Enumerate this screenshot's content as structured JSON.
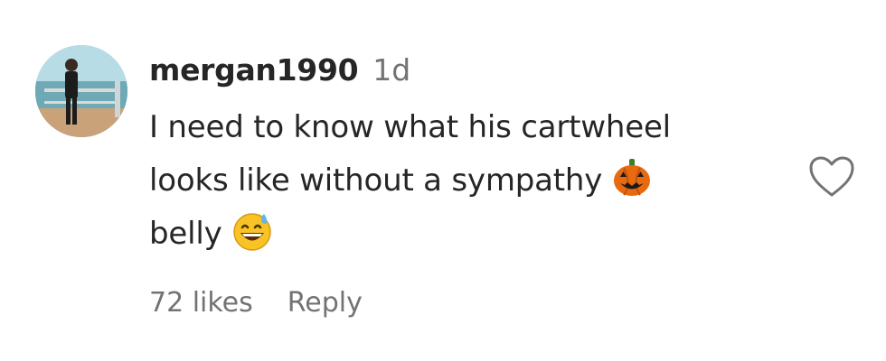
{
  "comment": {
    "username": "mergan1990",
    "time_ago": "1d",
    "text_line1": "I need to know what his cartwheel",
    "text_line2": "looks like without a sympathy",
    "text_line3": "belly",
    "emoji_1": "jack-o-lantern",
    "emoji_2": "grinning-face-with-sweat",
    "likes_label": "72 likes",
    "reply_label": "Reply",
    "like_icon": "heart-outline-icon"
  },
  "colors": {
    "primary_text": "#262626",
    "secondary_text": "#737373"
  }
}
